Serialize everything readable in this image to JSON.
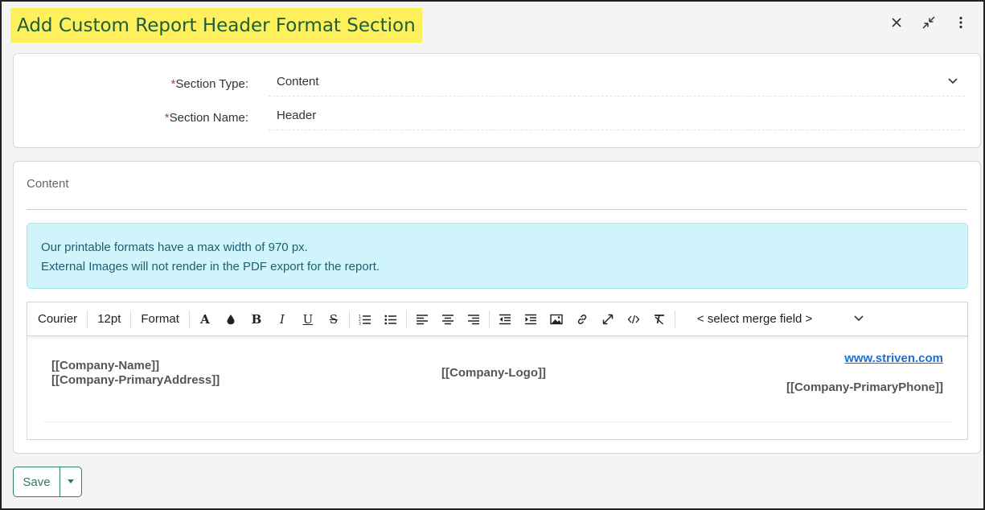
{
  "window": {
    "title": "Add Custom Report Header Format Section",
    "icons": [
      "close-icon",
      "collapse-icon",
      "more-vertical-icon"
    ]
  },
  "form": {
    "section_type": {
      "required_mark": "*",
      "label": "Section Type:",
      "value": "Content"
    },
    "section_name": {
      "required_mark": "*",
      "label": "Section Name:",
      "value": "Header"
    }
  },
  "content": {
    "label": "Content",
    "alert": {
      "line1": "Our printable formats have a max width of 970 px.",
      "line2": "External Images will not render in the PDF export for the report."
    },
    "toolbar": {
      "font": "Courier",
      "size": "12pt",
      "format": "Format",
      "bold_glyph": "B",
      "italic_glyph": "I",
      "underline_glyph": "U",
      "strike_glyph": "S",
      "font_color_glyph": "A",
      "merge_field_placeholder": "< select merge field >"
    },
    "editor": {
      "company_name": "[[Company-Name]]",
      "company_address": "[[Company-PrimaryAddress]]",
      "company_logo": "[[Company-Logo]]",
      "website": "www.striven.com",
      "company_phone": "[[Company-PrimaryPhone]]"
    }
  },
  "actions": {
    "save_label": "Save"
  },
  "colors": {
    "title_highlight": "#fdf05a",
    "title_text": "#1d5e3c",
    "required": "#c0392b",
    "alert_bg": "#cff4fb",
    "link": "#1a6fd6",
    "save_accent": "#2e7d5b"
  }
}
